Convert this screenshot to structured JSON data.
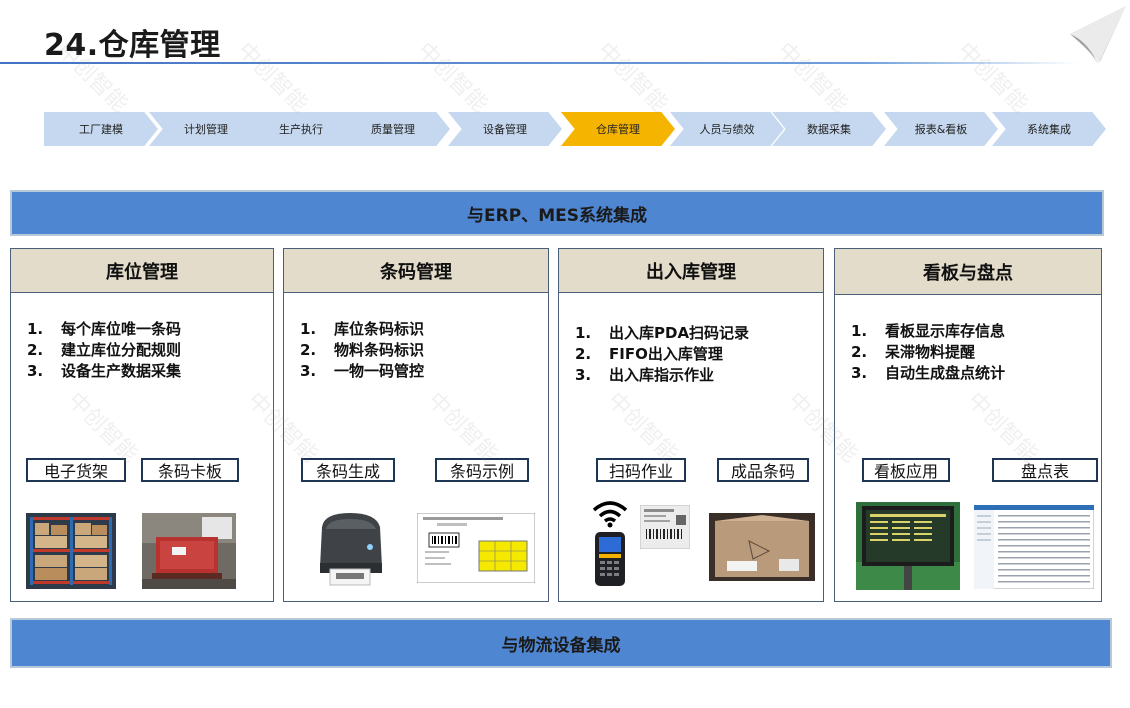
{
  "header": {
    "title": "24.仓库管理"
  },
  "process": {
    "steps": [
      "工厂建模",
      "计划管理",
      "生产执行",
      "质量管理",
      "设备管理",
      "仓库管理",
      "人员与绩效",
      "数据采集",
      "报表&看板",
      "系统集成"
    ],
    "active_index": 5
  },
  "bands": {
    "top": "与ERP、MES系统集成",
    "bottom": "与物流设备集成"
  },
  "panels": [
    {
      "title": "库位管理",
      "items": [
        "每个库位唯一条码",
        "建立库位分配规则",
        "设备生产数据采集"
      ],
      "tags": [
        "电子货架",
        "条码卡板"
      ]
    },
    {
      "title": "条码管理",
      "items": [
        "库位条码标识",
        "物料条码标识",
        "一物一码管控"
      ],
      "tags": [
        "条码生成",
        "条码示例"
      ]
    },
    {
      "title": "出入库管理",
      "items": [
        "出入库PDA扫码记录",
        "FIFO出入库管理",
        "出入库指示作业"
      ],
      "tags": [
        "扫码作业",
        "成品条码"
      ]
    },
    {
      "title": "看板与盘点",
      "items": [
        "看板显示库存信息",
        "呆滞物料提醒",
        "自动生成盘点统计"
      ],
      "tags": [
        "看板应用",
        "盘点表"
      ]
    }
  ],
  "numbers": [
    "1.",
    "2.",
    "3."
  ],
  "watermark": "中创智能",
  "colors": {
    "band": "#4f86d2",
    "step": "#c5d8ef",
    "step_active": "#f5b400",
    "panel_head": "#e4dccb"
  },
  "icons": [
    "page-curl-icon",
    "wifi-icon"
  ]
}
